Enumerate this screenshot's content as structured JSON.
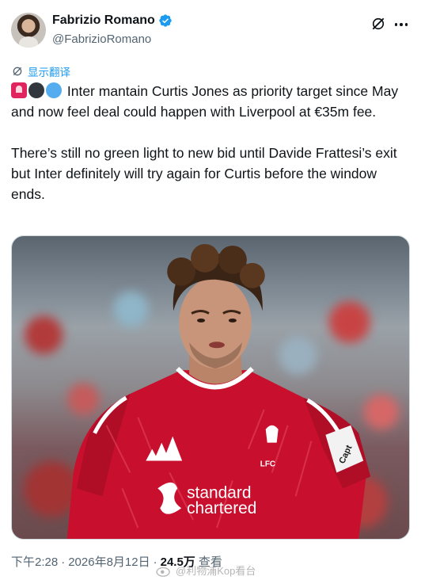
{
  "author": {
    "display_name": "Fabrizio Romano",
    "handle": "@FabrizioRomano"
  },
  "icons": {
    "verified": "verified-badge-icon",
    "grok": "grok-icon",
    "more": "more-options-icon",
    "translate": "translate-icon"
  },
  "translate_label": "显示翻译",
  "tweet": {
    "emojis": [
      "siren",
      "black-circle",
      "blue-circle"
    ],
    "paragraph_1": " Inter mantain Curtis Jones as priority target since May and now feel deal could happen with Liverpool at €35m fee.",
    "paragraph_2": "There’s still no green light to new bid until Davide Frattesi’s exit but Inter definitely will try again for Curtis before the window ends."
  },
  "media": {
    "shirt_sponsor_line1": "standard",
    "shirt_sponsor_line2": "chartered",
    "crest_text": "LFC",
    "armband_text": "Capt"
  },
  "meta": {
    "time": "下午2:28",
    "separator": "·",
    "date": "2026年8月12日",
    "separator2": "·",
    "views_count": "24.5万",
    "views_label": "查看"
  },
  "watermark": {
    "text": "@利物浦Kop看台"
  },
  "colors": {
    "accent": "#1d9bf0",
    "text": "#0f1419",
    "secondary": "#536471",
    "jersey": "#c8102e"
  }
}
